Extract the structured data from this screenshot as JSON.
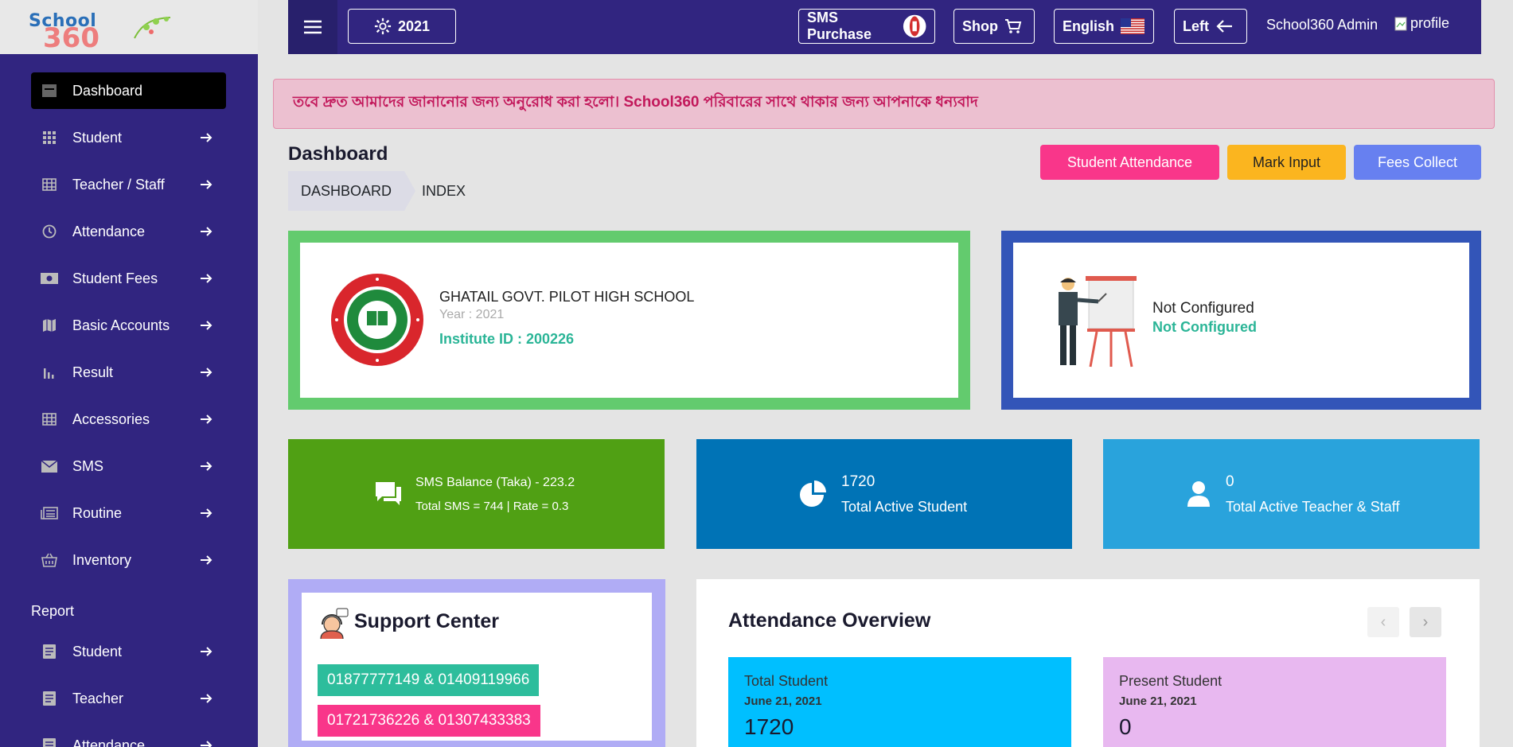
{
  "brand": {
    "logo_top": "School",
    "logo_bottom": "360"
  },
  "sidebar": {
    "items": [
      {
        "label": "Dashboard",
        "icon": "dashboard-icon",
        "active": true
      },
      {
        "label": "Student",
        "icon": "grid-icon"
      },
      {
        "label": "Teacher / Staff",
        "icon": "table-icon"
      },
      {
        "label": "Attendance",
        "icon": "clock-icon"
      },
      {
        "label": "Student Fees",
        "icon": "money-icon"
      },
      {
        "label": "Basic Accounts",
        "icon": "map-icon"
      },
      {
        "label": "Result",
        "icon": "bar-chart-icon"
      },
      {
        "label": "Accessories",
        "icon": "table-icon"
      },
      {
        "label": "SMS",
        "icon": "envelope-icon"
      },
      {
        "label": "Routine",
        "icon": "newspaper-icon"
      },
      {
        "label": "Inventory",
        "icon": "basket-icon"
      }
    ],
    "report_heading": "Report",
    "report_items": [
      {
        "label": "Student",
        "icon": "document-icon"
      },
      {
        "label": "Teacher",
        "icon": "document-icon"
      },
      {
        "label": "Attendance",
        "icon": "document-icon"
      }
    ]
  },
  "topbar": {
    "year_label": "2021",
    "sms_purchase_label": "SMS Purchase",
    "shop_label": "Shop",
    "language_label": "English",
    "direction_label": "Left",
    "admin_name": "School360 Admin",
    "profile_alt": "profile"
  },
  "notice": {
    "text": "তবে দ্রুত আমাদের জানানোর জন্য অনুরোধ করা হলো। School360 পরিবারের সাথে থাকার জন্য আপনাকে ধন্যবাদ"
  },
  "page": {
    "title": "Dashboard",
    "breadcrumb": [
      "DASHBOARD",
      "INDEX"
    ]
  },
  "actions": {
    "student_attendance": "Student Attendance",
    "mark_input": "Mark Input",
    "fees_collect": "Fees Collect"
  },
  "institute": {
    "name": "GHATAIL GOVT. PILOT HIGH SCHOOL",
    "year": "Year : 2021",
    "id_text": "Institute ID : 200226"
  },
  "config": {
    "title": "Not Configured",
    "subtitle": "Not Configured"
  },
  "stats": {
    "sms_balance": "SMS Balance (Taka) - 223.2",
    "sms_detail": "Total SMS = 744 | Rate = 0.3",
    "students_count": "1720",
    "students_label": "Total Active Student",
    "teachers_count": "0",
    "teachers_label": "Total Active Teacher & Staff"
  },
  "support": {
    "title": "Support Center",
    "phone1": "01877777149 & 01409119966",
    "phone2": "01721736226 & 01307433383"
  },
  "attendance": {
    "title": "Attendance Overview",
    "total_label": "Total Student",
    "total_date": "June 21, 2021",
    "total_value": "1720",
    "present_label": "Present Student",
    "present_date": "June 21, 2021",
    "present_value": "0"
  },
  "colors": {
    "sidebar_bg": "#312580",
    "green_border": "#63cb6e",
    "blue_border": "#3355b8",
    "sms_green": "#50a014",
    "student_blue": "#0073b6",
    "teacher_cyan": "#29a3dc"
  }
}
